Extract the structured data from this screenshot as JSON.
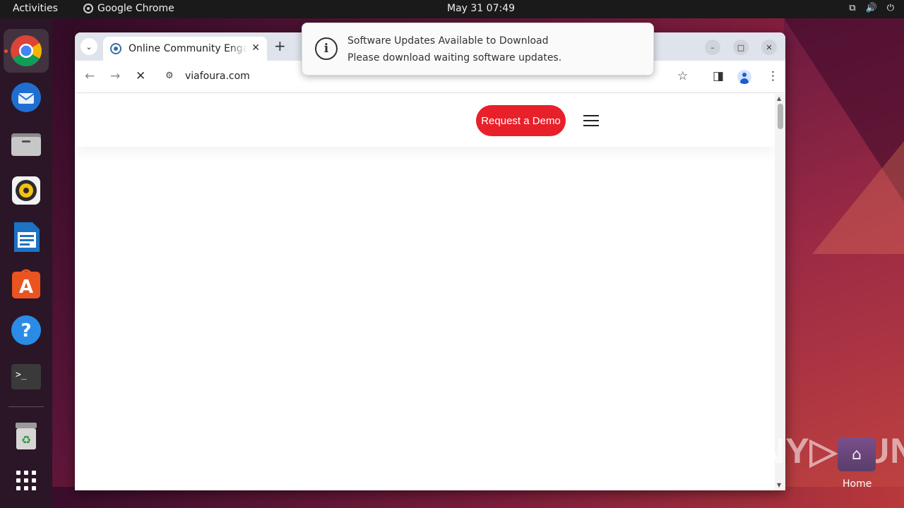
{
  "topbar": {
    "activities": "Activities",
    "app_name": "Google Chrome",
    "clock": "May 31  07:49",
    "tray_icons": [
      "network-icon",
      "volume-icon",
      "power-icon"
    ]
  },
  "dock": {
    "items": [
      "chrome",
      "thunderbird",
      "files",
      "rhythmbox",
      "libreoffice-writer",
      "app-center",
      "help",
      "terminal",
      "trash",
      "show-apps"
    ]
  },
  "browser": {
    "tab_title": "Online Community Engagement",
    "tab_close": "✕",
    "new_tab": "+",
    "url": "viafoura.com",
    "window_controls": {
      "minimize": "–",
      "maximize": "□",
      "close": "✕"
    }
  },
  "page": {
    "cta_label": "Request a Demo",
    "cta_color": "#e8202a"
  },
  "notification": {
    "title": "Software Updates Available to Download",
    "body": "Please download waiting software updates.",
    "icon": "i"
  },
  "desktop": {
    "home_label": "Home"
  },
  "watermark": "ANY.RUN"
}
